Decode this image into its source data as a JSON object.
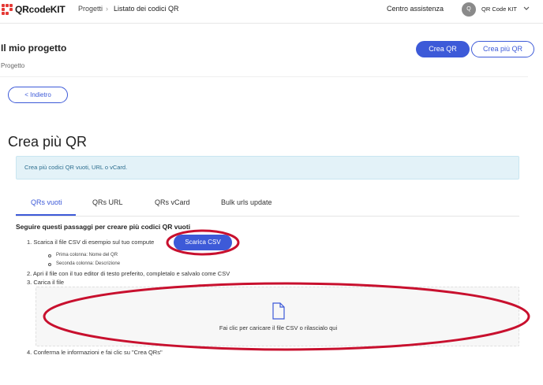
{
  "topbar": {
    "logo_text": "QRcodeKIT",
    "nav_projects": "Progetti",
    "nav_separator": "›",
    "nav_current": "Listato dei codici QR",
    "help_link": "Centro assistenza",
    "avatar_initial": "Q",
    "account_name": "QR Code KIT",
    "icons": {
      "logo": "logo-icon",
      "chevron": "chevron-down-icon"
    }
  },
  "project": {
    "title": "Il mio progetto",
    "subtitle": "Progetto",
    "create_qr_label": "Crea QR",
    "create_multiple_label": "Crea più QR",
    "back_label": "< Indietro"
  },
  "main": {
    "title": "Crea più QR",
    "info_text": "Crea più codici QR vuoti, URL o vCard.",
    "tabs": [
      {
        "label": "QRs vuoti",
        "active": true
      },
      {
        "label": "QRs URL",
        "active": false
      },
      {
        "label": "QRs vCard",
        "active": false
      },
      {
        "label": "Bulk urls update",
        "active": false
      }
    ],
    "steps_heading": "Seguire questi passaggi per creare più codici QR vuoti",
    "step1": "1. Scarica il file CSV di esempio sul tuo compute",
    "download_csv_label": "Scarica CSV",
    "step1_sub1": "Prima colonna: Nome del QR",
    "step1_sub2": "Seconda colonna: Descrizione",
    "step2": "2. Apri il file con il tuo editor di testo preferito, completalo e salvalo come CSV",
    "step3": "3. Carica il file",
    "dropzone_text": "Fai clic per caricare il file CSV o rilascialo qui",
    "step4": "4. Conferma le informazioni e fai clic su \"Crea QRs\"",
    "icons": {
      "upload": "file-icon"
    }
  },
  "colors": {
    "accent": "#3d5ad8",
    "logo_red": "#e53935",
    "info_bg": "#e3f2f8",
    "annotation_red": "#c8102e"
  }
}
